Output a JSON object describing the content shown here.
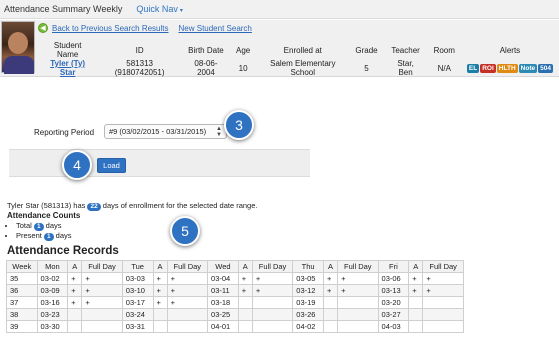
{
  "header": {
    "title": "Attendance Summary Weekly",
    "quick_nav": "Quick Nav"
  },
  "links": {
    "back": "Back to Previous Search Results",
    "new_search": "New Student Search"
  },
  "student": {
    "columns": [
      "Student Name",
      "ID",
      "Birth Date",
      "Age",
      "Enrolled at",
      "Grade",
      "Teacher",
      "Room",
      "Alerts"
    ],
    "name": "Tyler (Ty) Star",
    "id": "581313 (9180742051)",
    "birth_date": "08-06-2004",
    "age": "10",
    "enrolled_at": "Salem Elementary School",
    "grade": "5",
    "teacher": "Star, Ben",
    "room": "N/A",
    "alerts": [
      {
        "label": "EL",
        "color": "#1b7ea8"
      },
      {
        "label": "ROI",
        "color": "#c62f25"
      },
      {
        "label": "HLTH",
        "color": "#e08a13"
      },
      {
        "label": "Note",
        "color": "#2d8ab5"
      },
      {
        "label": "504",
        "color": "#2a70b0"
      }
    ]
  },
  "reporting": {
    "label": "Reporting Period",
    "selected": "#9 (03/02/2015 - 03/31/2015)"
  },
  "load_label": "Load",
  "callouts": [
    "3",
    "4",
    "5"
  ],
  "summary": {
    "line_prefix": "Tyler Star (581313) has",
    "days_enrolled": "22",
    "line_suffix": "days of enrollment for the selected date range.",
    "counts_title": "Attendance Counts",
    "total_label": "Total",
    "total": "1",
    "present_label": "Present",
    "present": "1",
    "days": "days"
  },
  "records": {
    "title": "Attendance Records",
    "columns": [
      "Week",
      "Mon",
      "A",
      "Full Day",
      "Tue",
      "A",
      "Full Day",
      "Wed",
      "A",
      "Full Day",
      "Thu",
      "A",
      "Full Day",
      "Fri",
      "A",
      "Full Day"
    ],
    "rows": [
      [
        "35",
        "03-02",
        "+",
        "+",
        "03-03",
        "+",
        "+",
        "03-04",
        "+",
        "+",
        "03-05",
        "+",
        "+",
        "03-06",
        "+",
        "+"
      ],
      [
        "36",
        "03-09",
        "+",
        "+",
        "03-10",
        "+",
        "+",
        "03-11",
        "+",
        "+",
        "03-12",
        "+",
        "+",
        "03-13",
        "+",
        "+"
      ],
      [
        "37",
        "03-16",
        "+",
        "+",
        "03-17",
        "+",
        "+",
        "03-18",
        "",
        "",
        "03-19",
        "",
        "",
        "03-20",
        "",
        ""
      ],
      [
        "38",
        "03-23",
        "",
        "",
        "03-24",
        "",
        "",
        "03-25",
        "",
        "",
        "03-26",
        "",
        "",
        "03-27",
        "",
        ""
      ],
      [
        "39",
        "03-30",
        "",
        "",
        "03-31",
        "",
        "",
        "04-01",
        "",
        "",
        "04-02",
        "",
        "",
        "04-03",
        "",
        ""
      ]
    ]
  }
}
